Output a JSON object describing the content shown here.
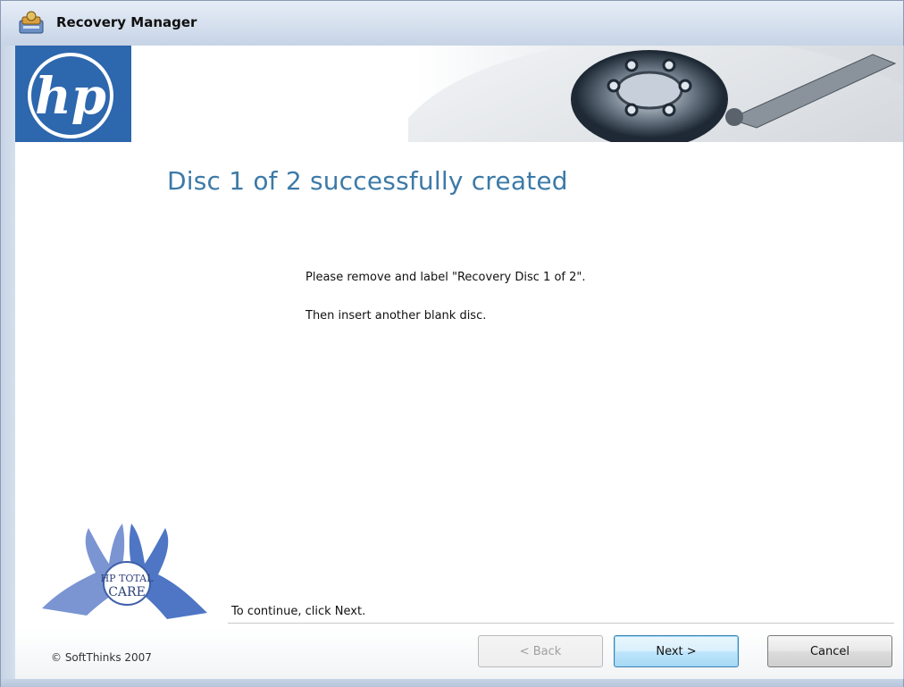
{
  "window": {
    "title": "Recovery Manager"
  },
  "banner": {
    "logo_text": "hp"
  },
  "main": {
    "heading": "Disc 1 of 2 successfully created",
    "message_line1": "Please remove and label \"Recovery Disc 1 of 2\".",
    "message_line2": "Then insert another blank disc.",
    "instruction": "To continue, click Next.",
    "care_logo_text_line1": "HP TOTAL",
    "care_logo_text_line2": "CARE"
  },
  "footer": {
    "copyright": "© SoftThinks 2007",
    "back_label": "< Back",
    "next_label": "Next >",
    "cancel_label": "Cancel"
  },
  "colors": {
    "heading": "#3c7aa8",
    "hp_blue": "#2d67ad",
    "hands_blue": "#6f8fd0"
  },
  "icons": {
    "title": "recovery-manager-icon",
    "banner_art": "hard-disk-platter-icon"
  }
}
